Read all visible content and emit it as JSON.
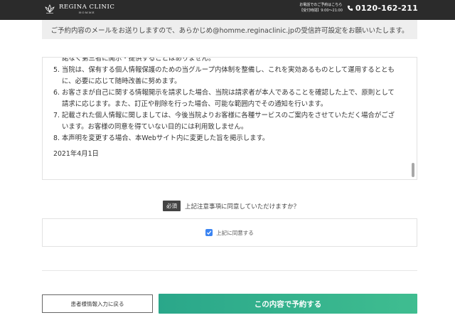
{
  "header": {
    "logo_title": "REGINA CLINIC",
    "logo_subtitle": "HOMME",
    "phone_note": "お電話でのご予約はこちら",
    "phone_hours": "【受付時間】9:00〜21:00",
    "phone_number": "0120-162-211"
  },
  "notice": {
    "text": "ご予約内容のメールをお送りしますので、あらかじめ@homme.reginaclinic.jpの受信許可設定をお願いいたします。"
  },
  "policy": {
    "partial_line": "諾なく第三者に開示・提供することはありません。",
    "items": [
      {
        "first": "5. 当院は、保有する個人情報保護のための当グループ内体制を整備し、これを実効あるものとして運用するととも",
        "rest": "に、必要に応じて随時改善に努めます。"
      },
      {
        "first": "6. お客さまが自己に関する情報開示を請求した場合、当院は請求者が本人であることを確認した上で、原則として",
        "rest": "請求に応じます。また、訂正や削除を行った場合、可能な範囲内でその通知を行います。"
      },
      {
        "first": "7. 記載された個人情報に関しましては、今後当院よりお客様に各種サービスのご案内をさせていただく場合がござ",
        "rest": "います。お客様の同意を得ていない目的には利用致しません。"
      },
      {
        "first": "8. 本声明を変更する場合、本Webサイト内に変更した旨を掲示します。",
        "rest": ""
      }
    ],
    "date": "2021年4月1日"
  },
  "agreement": {
    "required_label": "必須",
    "question": "上記注意事項に同意していただけますか？",
    "checkbox_label": "上記に同意する",
    "checked": true
  },
  "buttons": {
    "back_label": "患者様情報入力に戻る",
    "submit_label": "この内容で予約する"
  },
  "colors": {
    "header_bg": "#2b2b2b",
    "submit_start": "#2aa78a",
    "submit_end": "#3fbd90",
    "checkbox": "#3b84f2",
    "required_badge": "#444444"
  }
}
